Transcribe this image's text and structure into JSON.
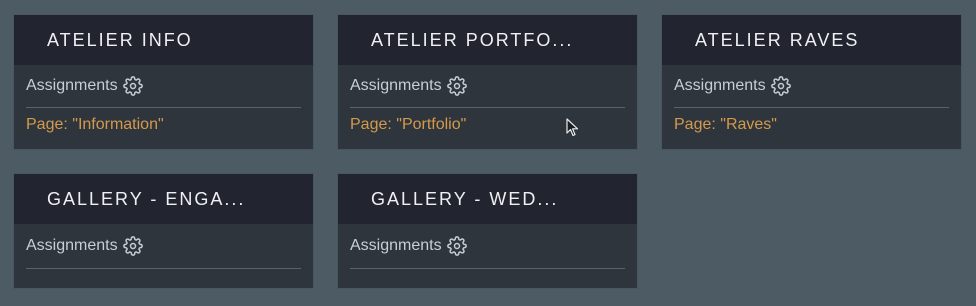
{
  "colors": {
    "background": "#4d5b65",
    "card_body": "#2e353d",
    "card_header": "#22252f",
    "page_link": "#d49a4c"
  },
  "cards": [
    {
      "title": "ATELIER INFO",
      "assignments_label": "Assignments",
      "page_label": "Page: \"Information\""
    },
    {
      "title": "ATELIER PORTFO...",
      "assignments_label": "Assignments",
      "page_label": "Page: \"Portfolio\""
    },
    {
      "title": "ATELIER RAVES",
      "assignments_label": "Assignments",
      "page_label": "Page: \"Raves\""
    },
    {
      "title": "GALLERY - ENGA...",
      "assignments_label": "Assignments"
    },
    {
      "title": "GALLERY - WED...",
      "assignments_label": "Assignments"
    }
  ]
}
